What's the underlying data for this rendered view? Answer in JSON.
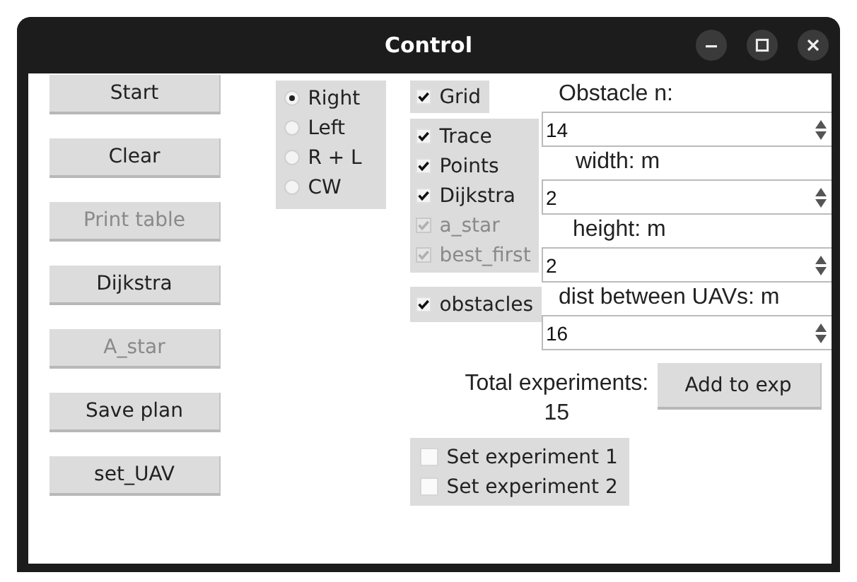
{
  "window": {
    "title": "Control"
  },
  "buttons": [
    {
      "label": "Start",
      "disabled": false
    },
    {
      "label": "Clear",
      "disabled": false
    },
    {
      "label": "Print table",
      "disabled": true
    },
    {
      "label": "Dijkstra",
      "disabled": false
    },
    {
      "label": "A_star",
      "disabled": true
    },
    {
      "label": "Save plan",
      "disabled": false
    },
    {
      "label": "set_UAV",
      "disabled": false
    }
  ],
  "directions": [
    {
      "label": "Right",
      "selected": true
    },
    {
      "label": "Left",
      "selected": false
    },
    {
      "label": "R + L",
      "selected": false
    },
    {
      "label": "CW",
      "selected": false
    }
  ],
  "option_groups": [
    {
      "options": [
        {
          "label": "Grid",
          "checked": true,
          "disabled": false
        }
      ]
    },
    {
      "options": [
        {
          "label": "Trace",
          "checked": true,
          "disabled": false
        },
        {
          "label": "Points",
          "checked": true,
          "disabled": false
        },
        {
          "label": "Dijkstra",
          "checked": true,
          "disabled": false
        },
        {
          "label": "a_star",
          "checked": true,
          "disabled": true
        },
        {
          "label": "best_first",
          "checked": true,
          "disabled": true
        }
      ]
    },
    {
      "options": [
        {
          "label": "obstacles",
          "checked": true,
          "disabled": false
        }
      ]
    }
  ],
  "fields": [
    {
      "label": "Obstacle n:",
      "value": "14"
    },
    {
      "label": "width: m",
      "value": "2"
    },
    {
      "label": "height: m",
      "value": "2"
    },
    {
      "label": "dist between UAVs: m",
      "value": "16"
    }
  ],
  "total": {
    "label": "Total experiments:",
    "count": "15"
  },
  "add_button": {
    "label": "Add to exp"
  },
  "experiments": [
    {
      "label": "Set experiment 1",
      "checked": false
    },
    {
      "label": "Set experiment 2",
      "checked": false
    }
  ]
}
